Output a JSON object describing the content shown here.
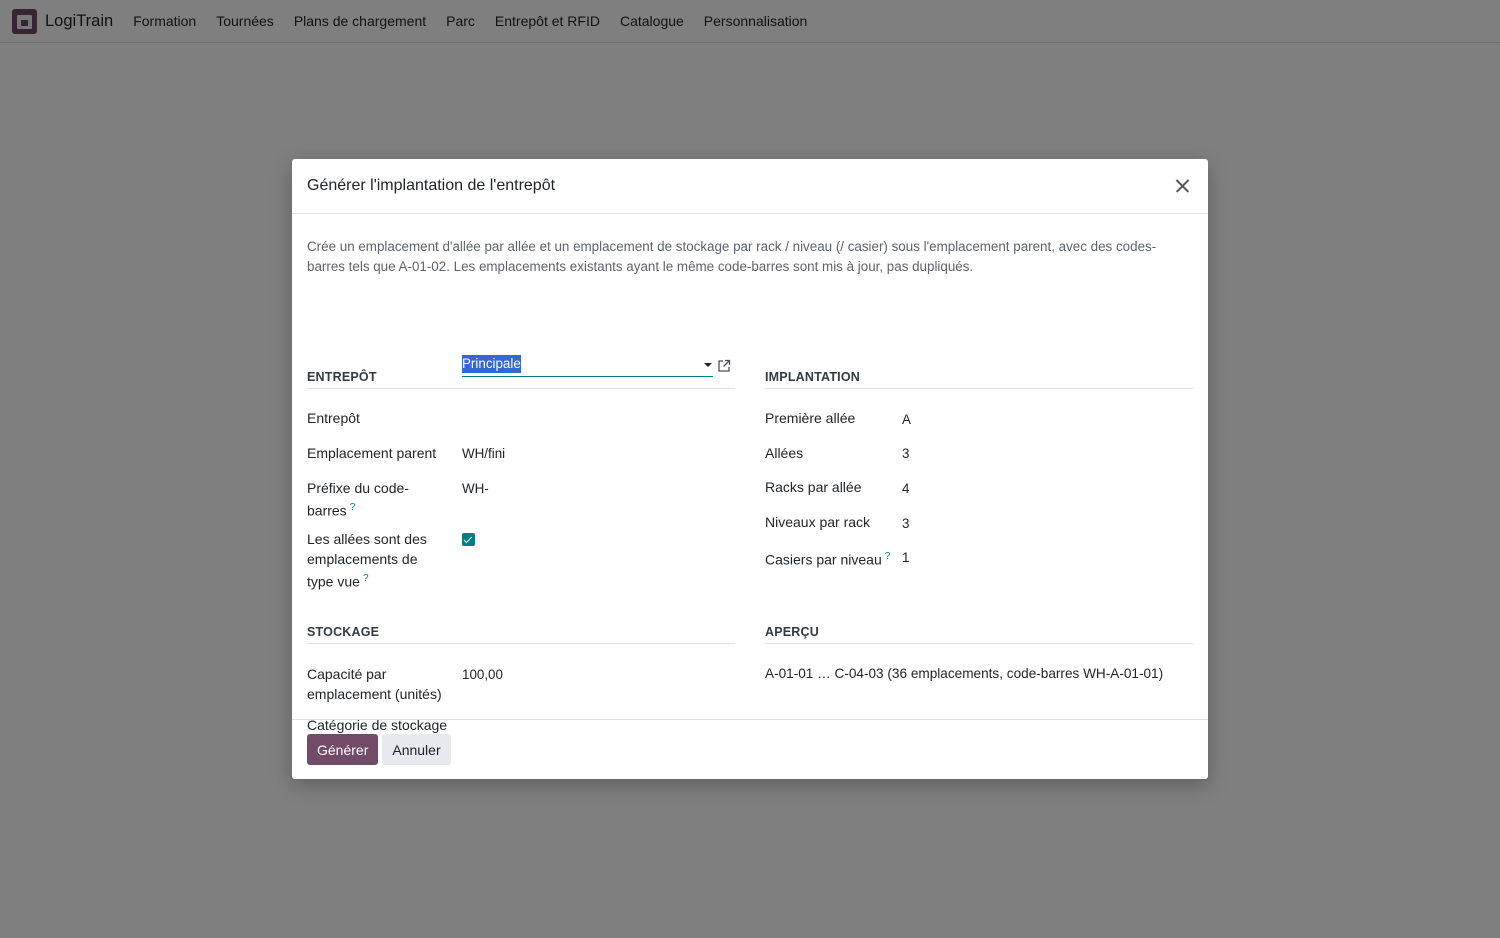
{
  "navbar": {
    "app_name": "LogiTrain",
    "menu": [
      "Formation",
      "Tournées",
      "Plans de chargement",
      "Parc",
      "Entrepôt et RFID",
      "Catalogue",
      "Personnalisation"
    ]
  },
  "dialog": {
    "title": "Générer l'implantation de l'entrepôt",
    "description": "Crée un emplacement d'allée par allée et un emplacement de stockage par rack / niveau (/ casier) sous l'emplacement parent, avec des codes-barres tels que A-01-02. Les emplacements existants ayant le même code-barres sont mis à jour, pas dupliqués.",
    "help_mark": "?",
    "entrepot_section": {
      "title": "ENTREPÔT",
      "warehouse_label": "Entrepôt",
      "warehouse_value": "Principale",
      "parent_label": "Emplacement parent",
      "parent_value": "WH/fini",
      "prefix_label": "Préfixe du code-barres",
      "prefix_value": "WH-",
      "aisles_view_label": "Les allées sont des emplacements de type vue",
      "aisles_view_checked": true
    },
    "implantation_section": {
      "title": "IMPLANTATION",
      "first_aisle_label": "Première allée",
      "first_aisle_value": "A",
      "aisles_label": "Allées",
      "aisles_value": "3",
      "racks_label": "Racks par allée",
      "racks_value": "4",
      "levels_label": "Niveaux par rack",
      "levels_value": "3",
      "bins_label": "Casiers par niveau",
      "bins_value": "1"
    },
    "stockage_section": {
      "title": "STOCKAGE",
      "capacity_label": "Capacité par emplacement (unités)",
      "capacity_value": "100,00",
      "category_label": "Catégorie de stockage",
      "category_value": ""
    },
    "apercu_section": {
      "title": "APERÇU",
      "preview": "A-01-01 … C-04-03 (36 emplacements, code-barres WH-A-01-01)"
    },
    "buttons": {
      "generate": "Générer",
      "cancel": "Annuler"
    }
  },
  "colors": {
    "brand": "#714b67",
    "accent": "#017e84",
    "selection": "#3367d6"
  }
}
